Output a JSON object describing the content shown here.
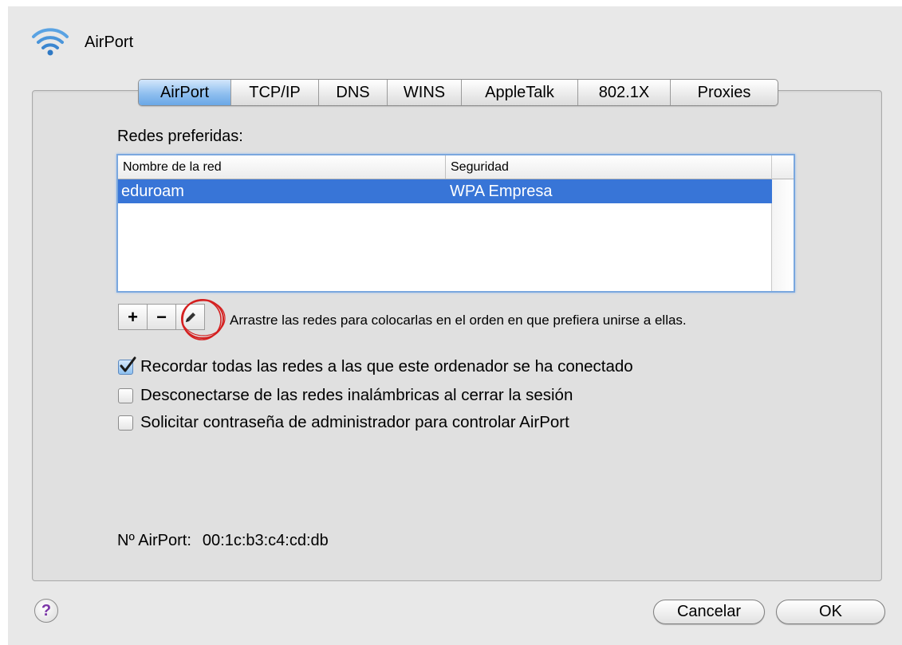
{
  "window": {
    "title": "AirPort"
  },
  "tabs": [
    {
      "label": "AirPort",
      "active": true
    },
    {
      "label": "TCP/IP",
      "active": false
    },
    {
      "label": "DNS",
      "active": false
    },
    {
      "label": "WINS",
      "active": false
    },
    {
      "label": "AppleTalk",
      "active": false
    },
    {
      "label": "802.1X",
      "active": false
    },
    {
      "label": "Proxies",
      "active": false
    }
  ],
  "preferred": {
    "label": "Redes preferidas:",
    "columns": [
      "Nombre de la red",
      "Seguridad"
    ],
    "rows": [
      {
        "name": "eduroam",
        "security": "WPA Empresa",
        "selected": true
      }
    ]
  },
  "buttons": {
    "add": "+",
    "remove": "−",
    "edit_icon": "pencil-icon"
  },
  "drag_hint": "Arrastre las redes para colocarlas en el orden en que prefiera unirse a ellas.",
  "options": [
    {
      "label": "Recordar todas las redes a las que este ordenador se ha conectado",
      "checked": true
    },
    {
      "label": "Desconectarse de las redes inalámbricas al cerrar la sesión",
      "checked": false
    },
    {
      "label": "Solicitar contraseña de administrador para controlar AirPort",
      "checked": false
    }
  ],
  "airport_id": {
    "label": "Nº AirPort:",
    "value": "00:1c:b3:c4:cd:db"
  },
  "footer": {
    "help": "?",
    "cancel": "Cancelar",
    "ok": "OK"
  },
  "colors": {
    "selection": "#3875d7",
    "annotation": "#d42020",
    "tab_active": "#8fbfef"
  }
}
